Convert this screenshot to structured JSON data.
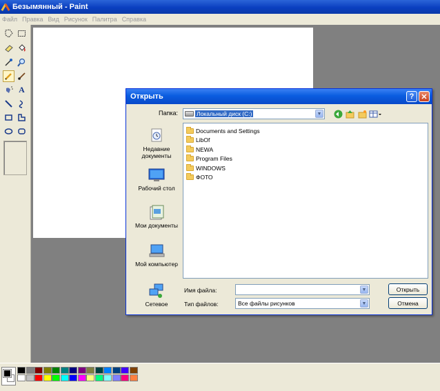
{
  "window": {
    "title": "Безымянный - Paint"
  },
  "menu": [
    "Файл",
    "Правка",
    "Вид",
    "Рисунок",
    "Палитра",
    "Справка"
  ],
  "tools": [
    {
      "name": "free-select-icon"
    },
    {
      "name": "rect-select-icon"
    },
    {
      "name": "eraser-icon"
    },
    {
      "name": "fill-icon"
    },
    {
      "name": "color-picker-icon"
    },
    {
      "name": "magnifier-icon"
    },
    {
      "name": "pencil-icon",
      "selected": true
    },
    {
      "name": "brush-icon"
    },
    {
      "name": "airbrush-icon"
    },
    {
      "name": "text-icon"
    },
    {
      "name": "line-icon"
    },
    {
      "name": "curve-icon"
    },
    {
      "name": "rectangle-icon"
    },
    {
      "name": "polygon-icon"
    },
    {
      "name": "ellipse-icon"
    },
    {
      "name": "rounded-rect-icon"
    }
  ],
  "palette": {
    "foreground": "#000000",
    "background": "#ffffff",
    "top_row": [
      "#000000",
      "#808080",
      "#800000",
      "#808000",
      "#008000",
      "#008080",
      "#000080",
      "#800080",
      "#808040",
      "#004040",
      "#0080ff",
      "#004080",
      "#4000ff",
      "#804000"
    ],
    "bottom_row": [
      "#ffffff",
      "#c0c0c0",
      "#ff0000",
      "#ffff00",
      "#00ff00",
      "#00ffff",
      "#0000ff",
      "#ff00ff",
      "#ffff80",
      "#00ff80",
      "#80ffff",
      "#8080ff",
      "#ff0080",
      "#ff8040"
    ]
  },
  "dialog": {
    "title": "Открыть",
    "help_label": "?",
    "look_in_label": "Папка:",
    "look_in_value": "Локальный диск (C:)",
    "places": [
      {
        "label": "Недавние документы",
        "icon": "recent-documents-icon"
      },
      {
        "label": "Рабочий стол",
        "icon": "desktop-icon"
      },
      {
        "label": "Мои документы",
        "icon": "my-documents-icon"
      },
      {
        "label": "Мой компьютер",
        "icon": "my-computer-icon"
      },
      {
        "label": "Сетевое",
        "icon": "network-icon"
      }
    ],
    "files": [
      "Documents and Settings",
      "LibOf",
      "NEWA",
      "Program Files",
      "WINDOWS",
      "ФОТО"
    ],
    "file_name_label": "Имя файла:",
    "file_name_value": "",
    "file_type_label": "Тип файлов:",
    "file_type_value": "Все файлы рисунков",
    "open_button": "Открыть",
    "cancel_button": "Отмена"
  }
}
